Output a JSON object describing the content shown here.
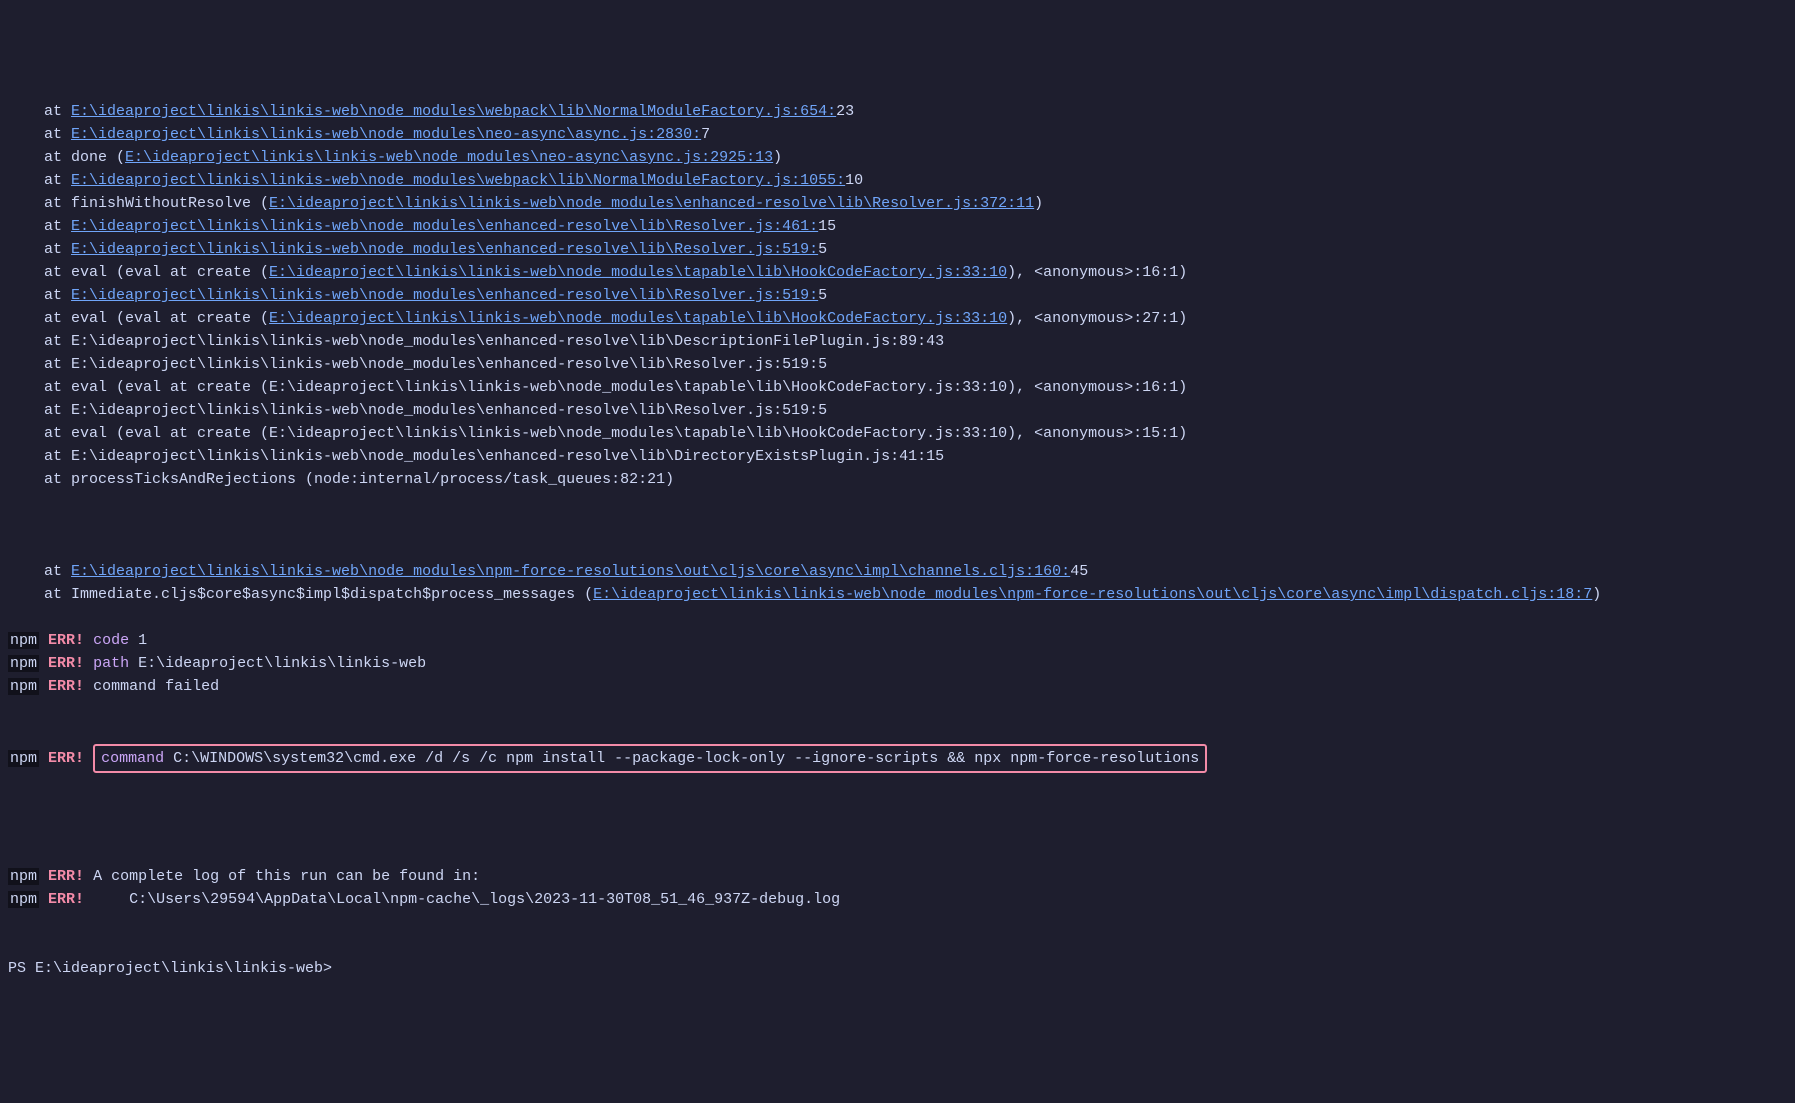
{
  "stack": [
    {
      "prefix": "    at ",
      "link": "E:\\ideaproject\\linkis\\linkis-web\\node_modules\\webpack\\lib\\NormalModuleFactory.js:654:",
      "suffix": "23"
    },
    {
      "prefix": "    at ",
      "link": "E:\\ideaproject\\linkis\\linkis-web\\node_modules\\neo-async\\async.js:2830:",
      "suffix": "7"
    },
    {
      "prefix": "    at done (",
      "link": "E:\\ideaproject\\linkis\\linkis-web\\node_modules\\neo-async\\async.js:2925:13",
      "suffix": ")"
    },
    {
      "prefix": "    at ",
      "link": "E:\\ideaproject\\linkis\\linkis-web\\node_modules\\webpack\\lib\\NormalModuleFactory.js:1055:",
      "suffix": "10"
    },
    {
      "prefix": "    at finishWithoutResolve (",
      "link": "E:\\ideaproject\\linkis\\linkis-web\\node_modules\\enhanced-resolve\\lib\\Resolver.js:372:11",
      "suffix": ")"
    },
    {
      "prefix": "    at ",
      "link": "E:\\ideaproject\\linkis\\linkis-web\\node_modules\\enhanced-resolve\\lib\\Resolver.js:461:",
      "suffix": "15"
    },
    {
      "prefix": "    at ",
      "link": "E:\\ideaproject\\linkis\\linkis-web\\node_modules\\enhanced-resolve\\lib\\Resolver.js:519:",
      "suffix": "5"
    },
    {
      "prefix": "    at eval (eval at create (",
      "link": "E:\\ideaproject\\linkis\\linkis-web\\node_modules\\tapable\\lib\\HookCodeFactory.js:33:10",
      "suffix": "), <anonymous>:16:1)"
    },
    {
      "prefix": "    at ",
      "link": "E:\\ideaproject\\linkis\\linkis-web\\node_modules\\enhanced-resolve\\lib\\Resolver.js:519:",
      "suffix": "5"
    },
    {
      "prefix": "    at eval (eval at create (",
      "link": "E:\\ideaproject\\linkis\\linkis-web\\node_modules\\tapable\\lib\\HookCodeFactory.js:33:10",
      "suffix": "), <anonymous>:27:1)"
    },
    {
      "prefix": "    at E:\\ideaproject\\linkis\\linkis-web\\node_modules\\enhanced-resolve\\lib\\DescriptionFilePlugin.js:89:43",
      "link": "",
      "suffix": ""
    },
    {
      "prefix": "    at E:\\ideaproject\\linkis\\linkis-web\\node_modules\\enhanced-resolve\\lib\\Resolver.js:519:5",
      "link": "",
      "suffix": ""
    },
    {
      "prefix": "    at eval (eval at create (E:\\ideaproject\\linkis\\linkis-web\\node_modules\\tapable\\lib\\HookCodeFactory.js:33:10), <anonymous>:16:1)",
      "link": "",
      "suffix": ""
    },
    {
      "prefix": "    at E:\\ideaproject\\linkis\\linkis-web\\node_modules\\enhanced-resolve\\lib\\Resolver.js:519:5",
      "link": "",
      "suffix": ""
    },
    {
      "prefix": "    at eval (eval at create (E:\\ideaproject\\linkis\\linkis-web\\node_modules\\tapable\\lib\\HookCodeFactory.js:33:10), <anonymous>:15:1)",
      "link": "",
      "suffix": ""
    },
    {
      "prefix": "    at E:\\ideaproject\\linkis\\linkis-web\\node_modules\\enhanced-resolve\\lib\\DirectoryExistsPlugin.js:41:15",
      "link": "",
      "suffix": ""
    },
    {
      "prefix": "    at processTicksAndRejections (node:internal/process/task_queues:82:21)",
      "link": "",
      "suffix": ""
    }
  ],
  "stack2": [
    {
      "prefix": "    at ",
      "link": "E:\\ideaproject\\linkis\\linkis-web\\node_modules\\npm-force-resolutions\\out\\cljs\\core\\async\\impl\\channels.cljs:160:",
      "suffix": "45"
    },
    {
      "prefix": "    at Immediate.cljs$core$async$impl$dispatch$process_messages (",
      "link": "E:\\ideaproject\\linkis\\linkis-web\\node_modules\\npm-force-resolutions\\out\\cljs\\core\\async\\impl\\dispatch.cljs:18:7",
      "suffix": ")"
    }
  ],
  "npm_errors": [
    {
      "kw": "code",
      "rest": " 1"
    },
    {
      "kw": "path",
      "rest": " E:\\ideaproject\\linkis\\linkis-web"
    },
    {
      "kw": "",
      "rest": "command failed"
    }
  ],
  "highlighted": {
    "kw": "command",
    "rest": " C:\\WINDOWS\\system32\\cmd.exe /d /s /c npm install --package-lock-only --ignore-scripts && npx npm-force-resolutions"
  },
  "npm_tail": [
    {
      "rest": "A complete log of this run can be found in:"
    },
    {
      "rest": "    C:\\Users\\29594\\AppData\\Local\\npm-cache\\_logs\\2023-11-30T08_51_46_937Z-debug.log"
    }
  ],
  "labels": {
    "npm": "npm",
    "err": "ERR!"
  },
  "prompt": "PS E:\\ideaproject\\linkis\\linkis-web> "
}
